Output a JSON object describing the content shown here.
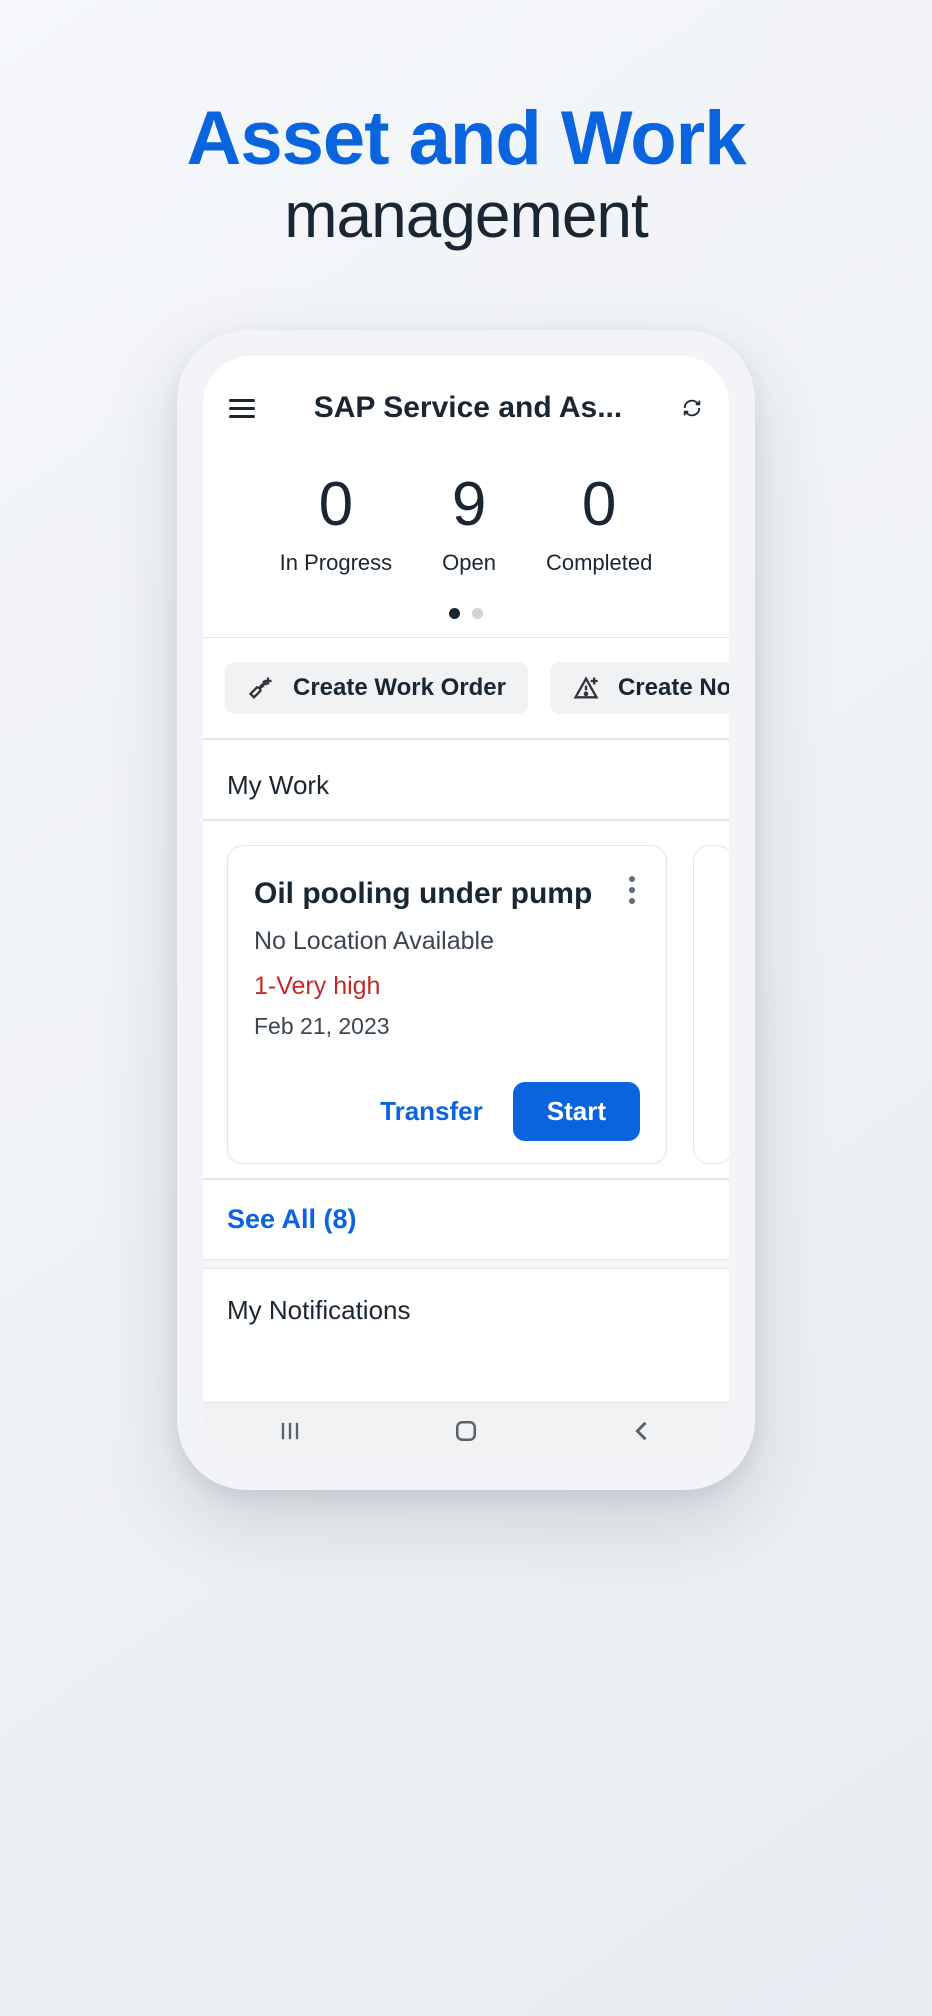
{
  "pageTitle": {
    "line1": "Asset and Work",
    "line2": "management"
  },
  "appBar": {
    "title": "SAP Service and As..."
  },
  "stats": [
    {
      "num": "0",
      "label": "In Progress"
    },
    {
      "num": "9",
      "label": "Open"
    },
    {
      "num": "0",
      "label": "Completed"
    }
  ],
  "actions": {
    "createWorkOrder": "Create Work Order",
    "createNotification": "Create Notificati"
  },
  "sections": {
    "myWork": "My Work",
    "myNotifications": "My Notifications"
  },
  "workCard": {
    "title": "Oil pooling under pump",
    "location": "No Location Available",
    "priority": "1-Very high",
    "date": "Feb 21, 2023",
    "transfer": "Transfer",
    "start": "Start"
  },
  "seeAll": "See All (8)"
}
